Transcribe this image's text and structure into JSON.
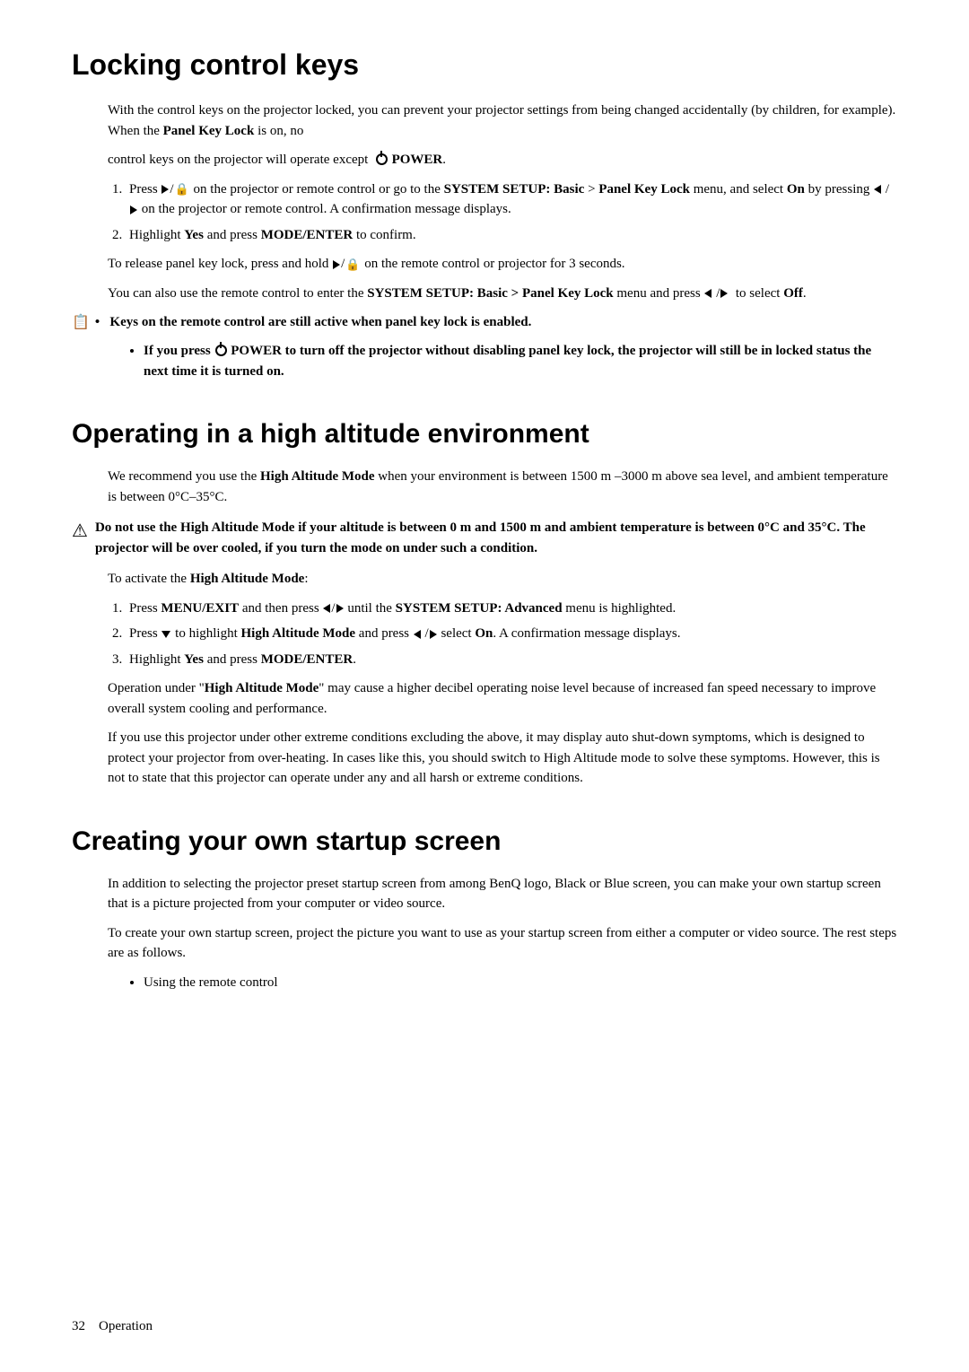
{
  "page": {
    "sections": [
      {
        "id": "locking-control-keys",
        "title": "Locking control keys",
        "level": 1
      },
      {
        "id": "operating-high-altitude",
        "title": "Operating in a high altitude environment",
        "level": 2
      },
      {
        "id": "creating-startup-screen",
        "title": "Creating your own startup screen",
        "level": 2
      }
    ],
    "footer": {
      "page_number": "32",
      "section_label": "Operation"
    }
  }
}
